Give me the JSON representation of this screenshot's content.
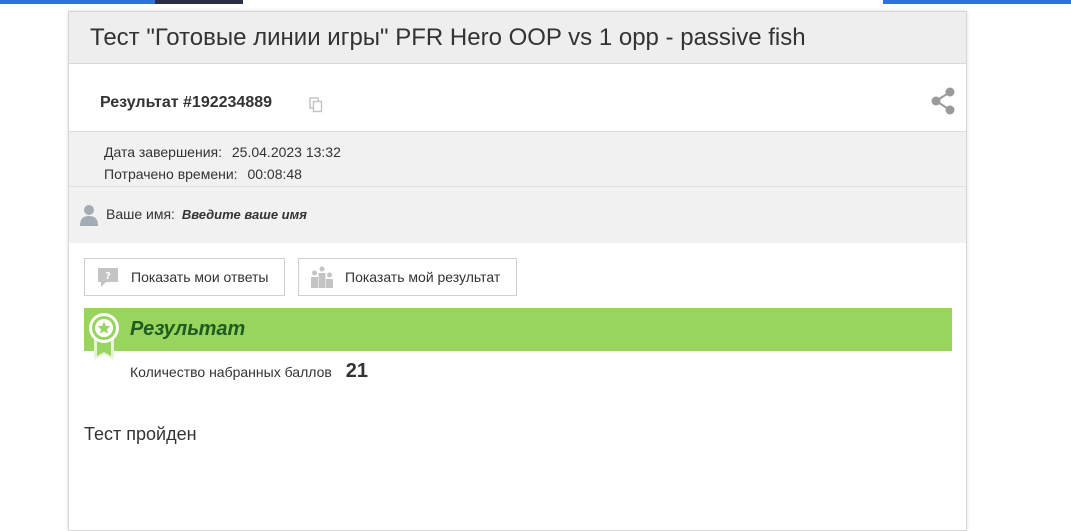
{
  "page": {
    "title": "Тест \"Готовые линии игры\" PFR Hero OOP vs 1 opp - passive fish"
  },
  "result": {
    "heading": "Результат #192234889",
    "icons": {
      "copy": "copy-icon",
      "share": "share-icon"
    }
  },
  "meta": {
    "finished_label": "Дата завершения:",
    "finished_value": "25.04.2023 13:32",
    "spent_label": "Потрачено времени:",
    "spent_value": "00:08:48"
  },
  "user": {
    "name_label": "Ваше имя:",
    "name_value": "Введите ваше имя",
    "icon": "person-icon"
  },
  "buttons": {
    "show_answers": "Показать мои ответы",
    "show_result": "Показать мой результат"
  },
  "result_panel": {
    "title": "Результат",
    "score_label": "Количество набранных баллов",
    "score_value": "21",
    "status": "Тест пройден",
    "accent_color": "#99d45f"
  }
}
